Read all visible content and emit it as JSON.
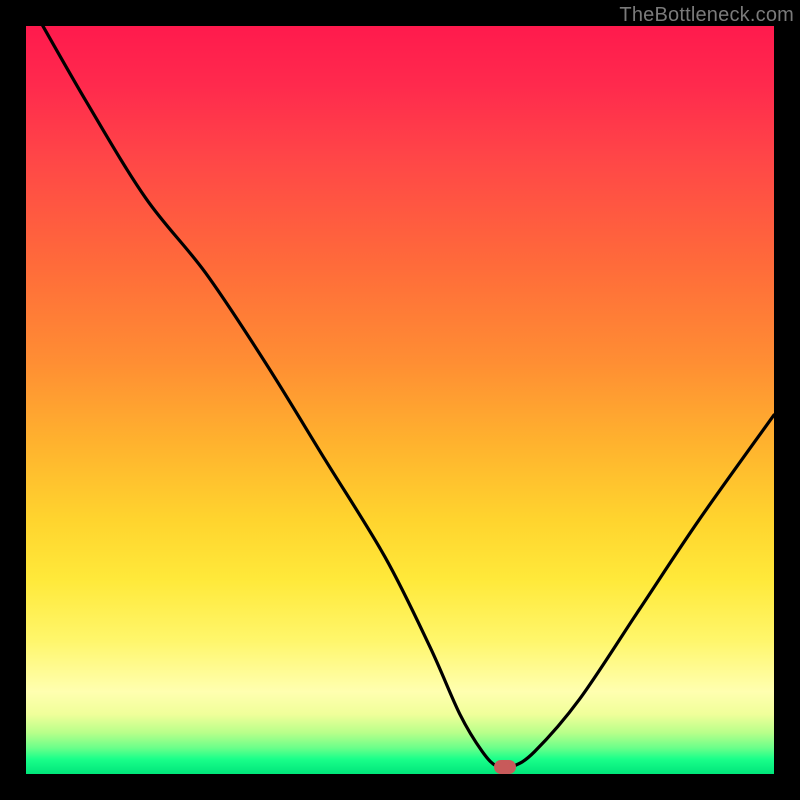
{
  "watermark": "TheBottleneck.com",
  "colors": {
    "background": "#000000",
    "curve": "#000000",
    "marker": "#c85a5a",
    "gradient_top": "#ff1a4d",
    "gradient_bottom": "#00e57a"
  },
  "chart_data": {
    "type": "line",
    "title": "",
    "xlabel": "",
    "ylabel": "",
    "xlim": [
      0,
      100
    ],
    "ylim": [
      0,
      100
    ],
    "grid": false,
    "series": [
      {
        "name": "bottleneck-curve",
        "x": [
          0,
          8,
          16,
          24,
          32,
          40,
          48,
          54,
          58,
          61,
          63,
          65,
          68,
          74,
          82,
          90,
          100
        ],
        "values": [
          104,
          90,
          77,
          67,
          55,
          42,
          29,
          17,
          8,
          3,
          1,
          1,
          3,
          10,
          22,
          34,
          48
        ]
      }
    ],
    "annotations": [
      {
        "name": "optimal-marker",
        "x": 64,
        "y": 1
      }
    ]
  }
}
